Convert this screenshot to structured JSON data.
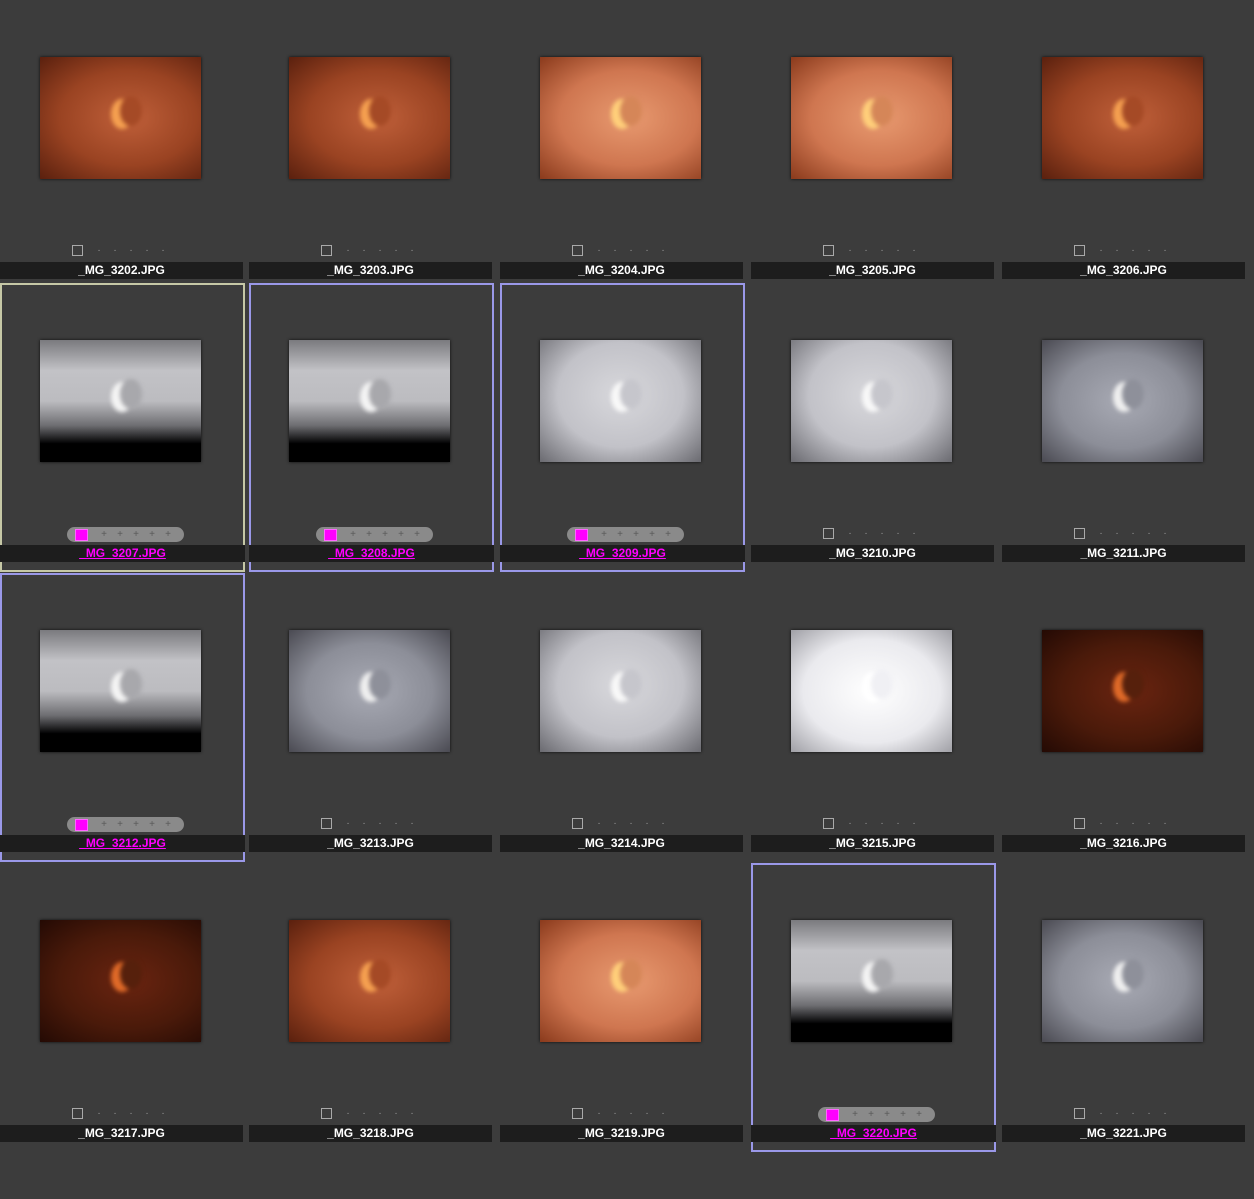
{
  "colors": {
    "tag": "#ff00ff",
    "selection_border": "#9a98e8",
    "primary_border": "#c6c8a6",
    "background": "#3c3c3c"
  },
  "cells": [
    {
      "name": "_MG_3202.JPG",
      "tone": "red",
      "state": "none",
      "tagged": false
    },
    {
      "name": "_MG_3203.JPG",
      "tone": "red",
      "state": "none",
      "tagged": false
    },
    {
      "name": "_MG_3204.JPG",
      "tone": "salmon",
      "state": "none",
      "tagged": false
    },
    {
      "name": "_MG_3205.JPG",
      "tone": "salmon",
      "state": "none",
      "tagged": false
    },
    {
      "name": "_MG_3206.JPG",
      "tone": "red",
      "state": "none",
      "tagged": false
    },
    {
      "name": "_MG_3207.JPG",
      "tone": "grey-dark-bottom",
      "state": "primary",
      "tagged": true
    },
    {
      "name": "_MG_3208.JPG",
      "tone": "grey-dark-bottom",
      "state": "selected",
      "tagged": true
    },
    {
      "name": "_MG_3209.JPG",
      "tone": "grey-light",
      "state": "selected",
      "tagged": true
    },
    {
      "name": "_MG_3210.JPG",
      "tone": "grey-light",
      "state": "none",
      "tagged": false
    },
    {
      "name": "_MG_3211.JPG",
      "tone": "grey-mid",
      "state": "none",
      "tagged": false
    },
    {
      "name": "_MG_3212.JPG",
      "tone": "grey-dark-bottom",
      "state": "selected",
      "tagged": true
    },
    {
      "name": "_MG_3213.JPG",
      "tone": "grey-mid",
      "state": "none",
      "tagged": false
    },
    {
      "name": "_MG_3214.JPG",
      "tone": "grey-light",
      "state": "none",
      "tagged": false
    },
    {
      "name": "_MG_3215.JPG",
      "tone": "white",
      "state": "none",
      "tagged": false
    },
    {
      "name": "_MG_3216.JPG",
      "tone": "dark-red",
      "state": "none",
      "tagged": false
    },
    {
      "name": "_MG_3217.JPG",
      "tone": "dark-red",
      "state": "none",
      "tagged": false
    },
    {
      "name": "_MG_3218.JPG",
      "tone": "red",
      "state": "none",
      "tagged": false
    },
    {
      "name": "_MG_3219.JPG",
      "tone": "salmon",
      "state": "none",
      "tagged": false
    },
    {
      "name": "_MG_3220.JPG",
      "tone": "grey-dark-bottom",
      "state": "selected",
      "tagged": true
    },
    {
      "name": "_MG_3221.JPG",
      "tone": "grey-mid",
      "state": "none",
      "tagged": false
    }
  ]
}
